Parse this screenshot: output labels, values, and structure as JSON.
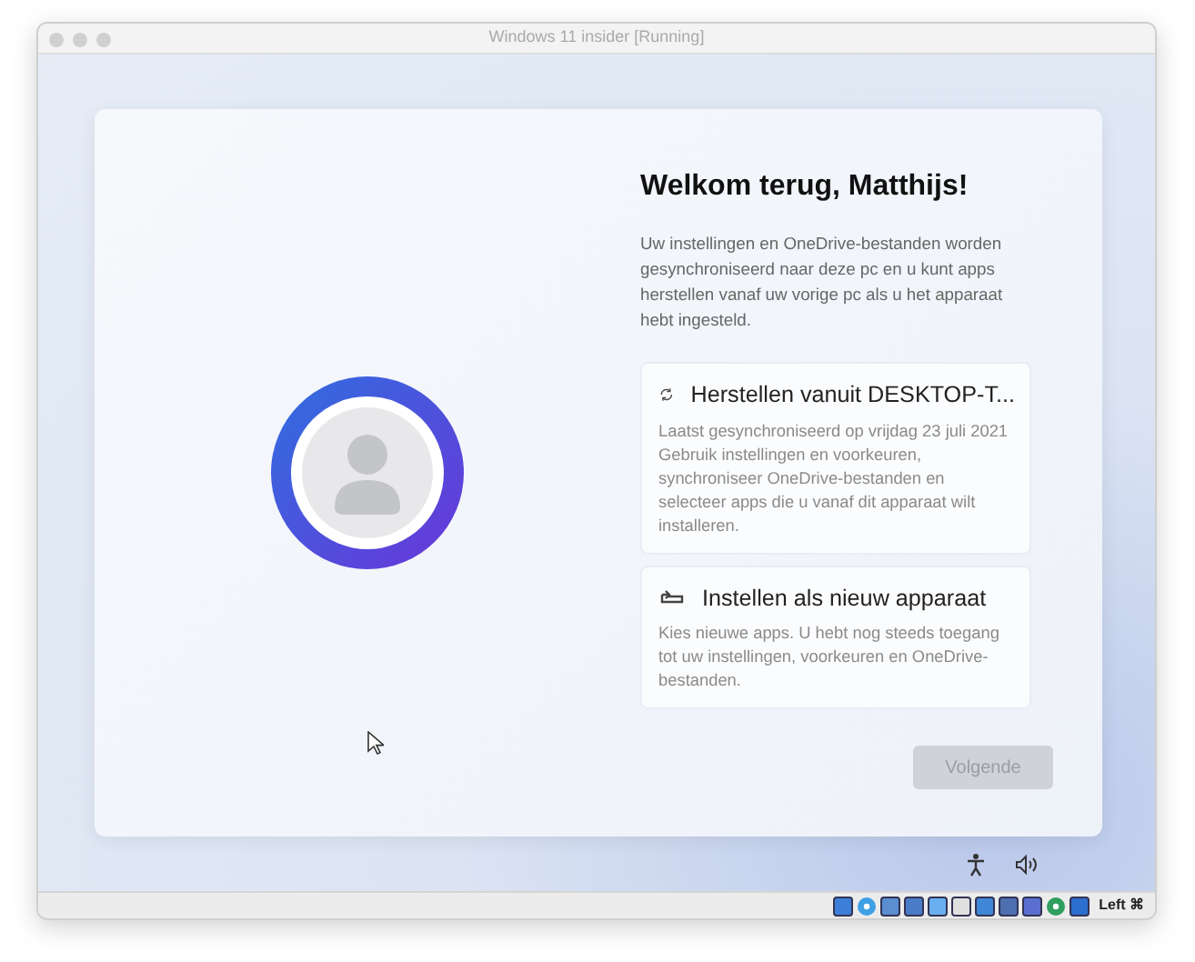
{
  "window": {
    "title": "Windows 11 insider [Running]"
  },
  "setup": {
    "title": "Welkom terug, Matthijs!",
    "description": "Uw instellingen en OneDrive-bestanden worden gesynchroniseerd naar deze pc en u kunt apps herstellen vanaf uw vorige pc als u het apparaat hebt ingesteld.",
    "options": [
      {
        "kind": "restore",
        "title": "Herstellen vanuit DESKTOP-T...",
        "description": "Laatst gesynchroniseerd op vrijdag 23 juli 2021 Gebruik instellingen en voorkeuren, synchroniseer OneDrive-bestanden en selecteer apps die u vanaf dit apparaat wilt installeren."
      },
      {
        "kind": "new",
        "title": "Instellen als nieuw apparaat",
        "description": "Kies nieuwe apps. U hebt nog steeds toegang tot uw instellingen, voorkeuren en OneDrive-bestanden."
      }
    ],
    "next_button": {
      "label": "Volgende",
      "disabled": true
    }
  },
  "status_bar": {
    "host_key": "Left ⌘"
  }
}
